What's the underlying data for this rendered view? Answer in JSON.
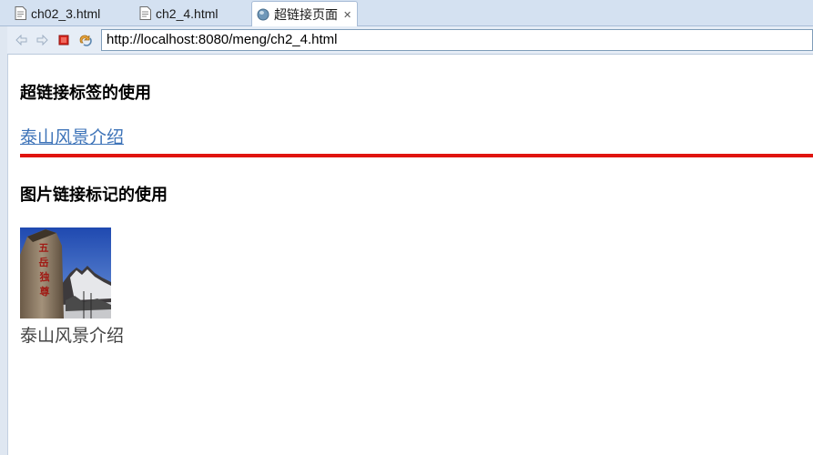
{
  "tabs": [
    {
      "label": "ch02_3.html",
      "icon": "html-file-icon",
      "active": false
    },
    {
      "label": "ch2_4.html",
      "icon": "html-file-icon",
      "active": false
    },
    {
      "label": "超链接页面",
      "icon": "globe-icon",
      "active": true,
      "close_glyph": "✕"
    }
  ],
  "toolbar": {
    "back_icon": "back-arrow-icon",
    "forward_icon": "forward-arrow-icon",
    "stop_icon": "stop-icon",
    "refresh_icon": "refresh-icon",
    "url": "http://localhost:8080/meng/ch2_4.html"
  },
  "page": {
    "heading1": "超链接标签的使用",
    "link_text": "泰山风景介绍",
    "divider_color": "#e0140f",
    "heading2": "图片链接标记的使用",
    "image_alt": "泰山风景",
    "image_inscription": "五岳独尊",
    "caption": "泰山风景介绍"
  },
  "colors": {
    "link": "#3d73b8",
    "tabbar_bg": "#d4e1f1",
    "toolbar_bg": "#e6edf6"
  }
}
